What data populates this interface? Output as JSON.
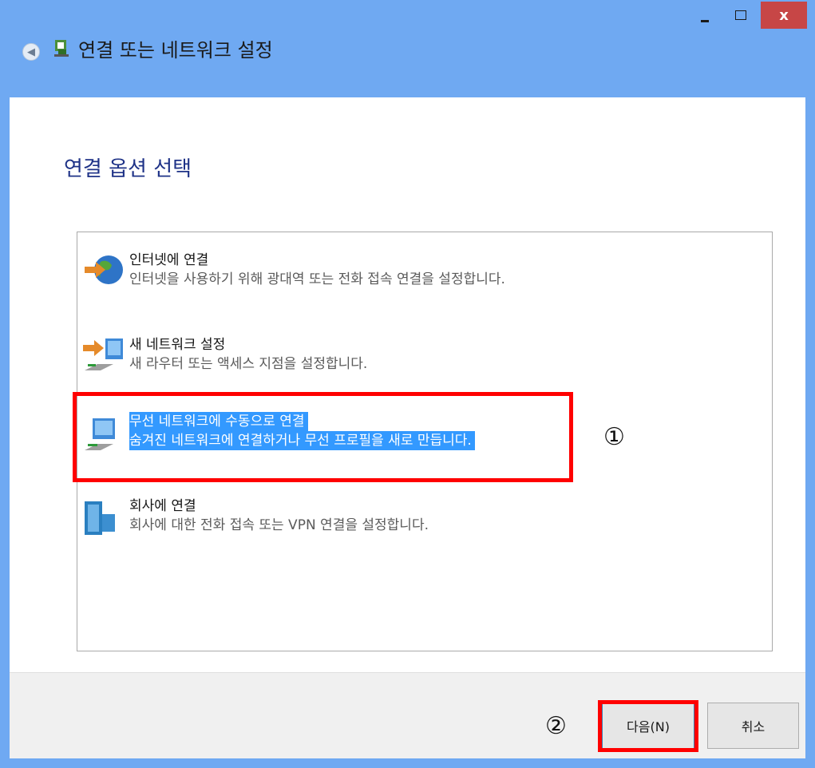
{
  "window": {
    "minimize_label": "",
    "maximize_label": "",
    "close_label": "x",
    "colors": {
      "titlebar": "#6fa9f2",
      "close": "#c74646",
      "selection": "#3399ff",
      "heading": "#1e3287"
    }
  },
  "nav": {
    "back_icon": "back-arrow-icon",
    "app_icon": "network-setup-icon",
    "title": "연결 또는 네트워크 설정"
  },
  "main": {
    "heading": "연결 옵션 선택",
    "options": [
      {
        "icon": "globe-internet-icon",
        "title": "인터넷에 연결",
        "description": "인터넷을 사용하기 위해 광대역 또는 전화 접속 연결을 설정합니다."
      },
      {
        "icon": "router-network-icon",
        "title": "새 네트워크 설정",
        "description": "새 라우터 또는 액세스 지점을 설정합니다."
      },
      {
        "icon": "wireless-network-icon",
        "title": "무선 네트워크에 수동으로 연결",
        "description": "숨겨진 네트워크에 연결하거나 무선 프로필을 새로 만듭니다.",
        "selected": true
      },
      {
        "icon": "workplace-building-icon",
        "title": "회사에 연결",
        "description": "회사에 대한 전화 접속 또는 VPN 연결을 설정합니다."
      }
    ]
  },
  "annotations": {
    "marker1": "①",
    "marker2": "②"
  },
  "footer": {
    "next_label": "다음(N)",
    "cancel_label": "취소"
  }
}
